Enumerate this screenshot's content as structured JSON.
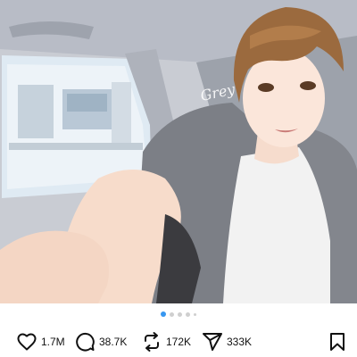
{
  "post": {
    "image": {
      "description_icon": "illustration-image",
      "signature": "Grey"
    },
    "carousel": {
      "total_dots": 5,
      "active_index": 0
    },
    "actions": {
      "likes": "1.7M",
      "comments": "38.7K",
      "reposts": "172K",
      "shares": "333K"
    },
    "colors": {
      "accent": "#3897f0",
      "icon": "#111111"
    }
  }
}
